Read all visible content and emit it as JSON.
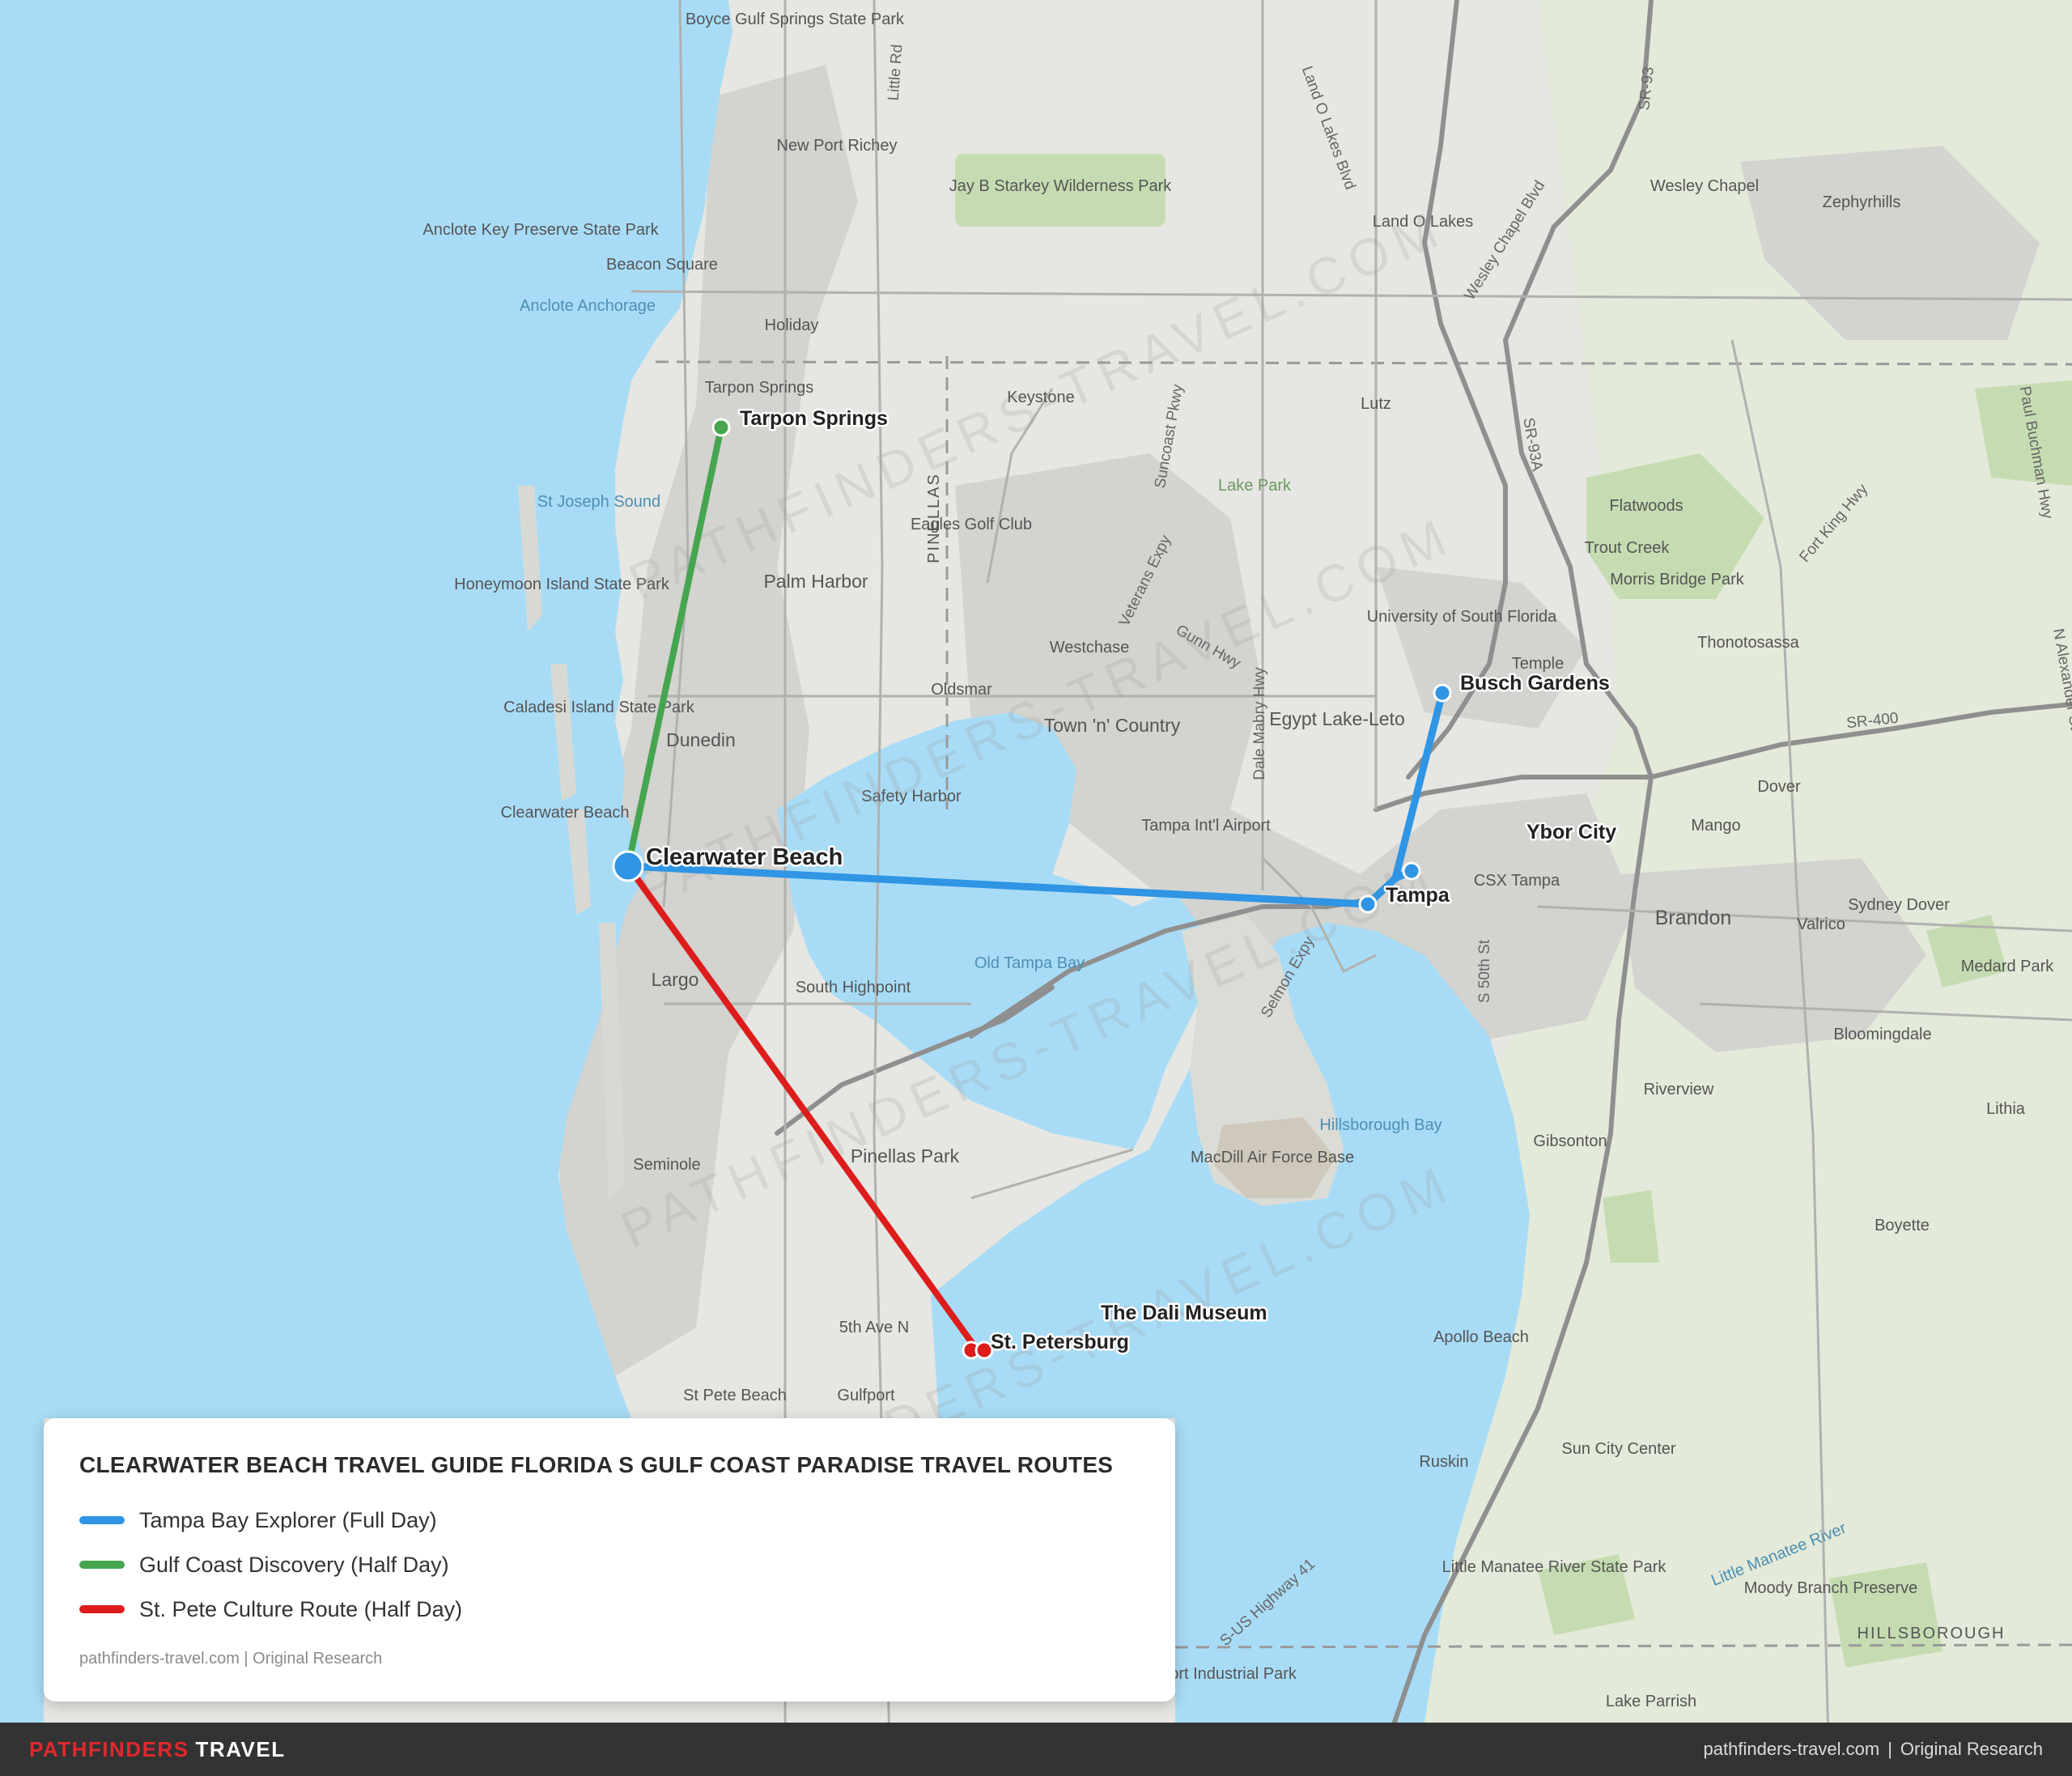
{
  "map": {
    "water_labels": [
      "Anclote Anchorage",
      "St Joseph Sound",
      "Old Tampa Bay",
      "Hillsborough Bay",
      "Little Manatee River"
    ],
    "place_labels": [
      "Boyce Gulf Springs State Park",
      "New Port Richey",
      "Jay B Starkey Wilderness Park",
      "Anclote Key Preserve State Park",
      "Beacon Square",
      "Holiday",
      "Tarpon Springs",
      "Keystone",
      "Land O Lakes",
      "Wesley Chapel",
      "Zephyrhills",
      "Lutz",
      "Lake Park",
      "Flatwoods",
      "Trout Creek",
      "Morris Bridge Park",
      "Thonotosassa",
      "Honeymoon Island State Park",
      "Palm Harbor",
      "Eagles Golf Club",
      "University of South Florida",
      "Temple",
      "Westchase",
      "Oldsmar",
      "Egypt Lake-Leto",
      "Caladesi Island State Park",
      "Dunedin",
      "Town 'n' Country",
      "Safety Harbor",
      "Tampa Int'l Airport",
      "Dover",
      "Clearwater Beach",
      "Mango",
      "CSX Tampa",
      "Brandon",
      "Valrico",
      "Sydney Dover",
      "Largo",
      "South Highpoint",
      "Medard Park",
      "Bloomingdale",
      "Riverview",
      "Lithia",
      "Seminole",
      "Pinellas Park",
      "MacDill Air Force Base",
      "Gibsonton",
      "Boyette",
      "Apollo Beach",
      "5th Ave N",
      "St Pete Beach",
      "Gulfport",
      "Ruskin",
      "Sun City Center",
      "Little Manatee River State Park",
      "Eastport Industrial Park",
      "Moody Branch Preserve",
      "Lake Parrish",
      "HILLSBOROUGH",
      "PINELLAS"
    ],
    "road_labels": [
      "SR-93",
      "Land O Lakes Blvd",
      "Wesley Chapel Blvd",
      "SR-93A",
      "Suncoast Pkwy",
      "Veterans Expy",
      "Gunn Hwy",
      "Dale Mabry Hwy",
      "SR-400",
      "Selmon Expy",
      "S 50th St",
      "S-US Highway 41",
      "Paul Buchman Hwy",
      "Fort King Hwy",
      "N Alexander St",
      "Little Rd"
    ],
    "watermark": "PATHFINDERS-TRAVEL.COM"
  },
  "routes": [
    {
      "name": "Tampa Bay Explorer (Full Day)",
      "color": "#2f95e4"
    },
    {
      "name": "Gulf Coast Discovery (Half Day)",
      "color": "#46a54f"
    },
    {
      "name": "St. Pete Culture Route (Half Day)",
      "color": "#dd1c1c"
    }
  ],
  "stops": [
    {
      "name": "Clearwater Beach"
    },
    {
      "name": "Tarpon Springs"
    },
    {
      "name": "Busch Gardens"
    },
    {
      "name": "Ybor City"
    },
    {
      "name": "Tampa"
    },
    {
      "name": "St. Petersburg"
    },
    {
      "name": "The Dali Museum"
    }
  ],
  "legend": {
    "title": "CLEARWATER BEACH TRAVEL GUIDE FLORIDA S GULF COAST PARADISE TRAVEL ROUTES",
    "source": "pathfinders-travel.com | Original Research"
  },
  "footer": {
    "brand_red": "PATHFINDERS",
    "brand_white": "TRAVEL",
    "site": "pathfinders-travel.com",
    "separator": "|",
    "note": "Original Research"
  }
}
